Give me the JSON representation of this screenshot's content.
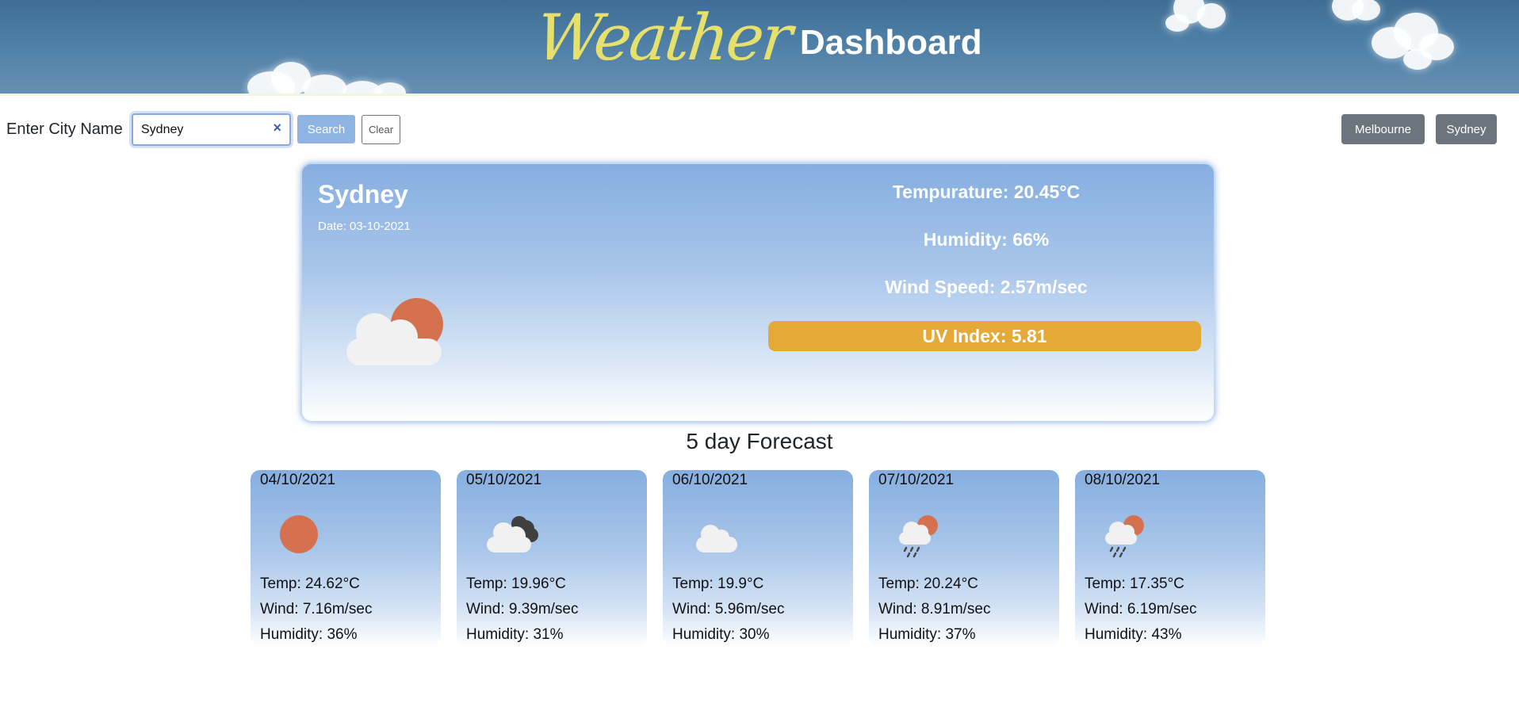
{
  "header": {
    "title_script": "Weather",
    "title_main": "Dashboard"
  },
  "search": {
    "label": "Enter City Name",
    "value": "Sydney",
    "clear_icon": "×",
    "search_label": "Search",
    "clear_label": "Clear"
  },
  "history": [
    "Melbourne",
    "Sydney"
  ],
  "current": {
    "city": "Sydney",
    "date": "Date: 03-10-2021",
    "icon": "sun-behind-cloud-icon",
    "temperature": "Tempurature: 20.45°C",
    "humidity": "Humidity: 66%",
    "wind": "Wind Speed: 2.57m/sec",
    "uv": "UV Index: 5.81",
    "uv_color": "#e5a937"
  },
  "forecast": {
    "title": "5 day Forecast",
    "days": [
      {
        "date": "04/10/2021",
        "icon": "sun-icon",
        "temp": "Temp: 24.62°C",
        "wind": "Wind: 7.16m/sec",
        "humidity": "Humidity: 36%"
      },
      {
        "date": "05/10/2021",
        "icon": "broken-clouds-icon",
        "temp": "Temp: 19.96°C",
        "wind": "Wind: 9.39m/sec",
        "humidity": "Humidity: 31%"
      },
      {
        "date": "06/10/2021",
        "icon": "cloud-icon",
        "temp": "Temp: 19.9°C",
        "wind": "Wind: 5.96m/sec",
        "humidity": "Humidity: 30%"
      },
      {
        "date": "07/10/2021",
        "icon": "sun-rain-cloud-icon",
        "temp": "Temp: 20.24°C",
        "wind": "Wind: 8.91m/sec",
        "humidity": "Humidity: 37%"
      },
      {
        "date": "08/10/2021",
        "icon": "sun-rain-cloud-icon",
        "temp": "Temp: 17.35°C",
        "wind": "Wind: 6.19m/sec",
        "humidity": "Humidity: 43%"
      }
    ]
  },
  "colors": {
    "sun": "#d5714f",
    "cloud": "#f1f1f1",
    "dark_cloud": "#3f3f3f",
    "card_top": "#86aee0",
    "button_gray": "#6c757d",
    "title_yellow": "#e6e06d"
  }
}
